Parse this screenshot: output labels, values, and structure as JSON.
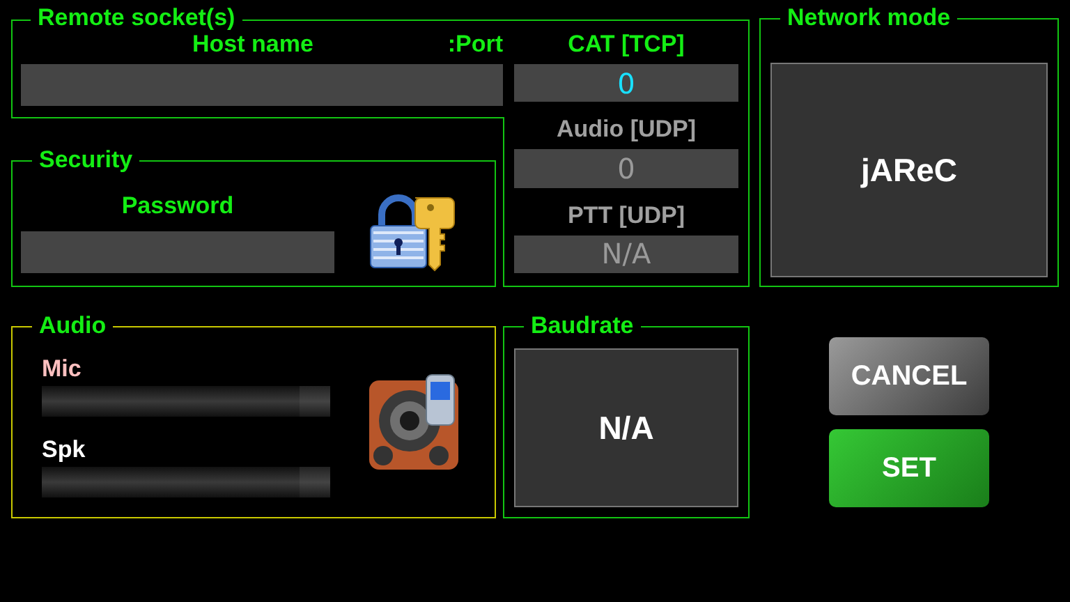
{
  "remote": {
    "legend": "Remote socket(s)",
    "host_label": "Host name",
    "port_label": ":Port"
  },
  "ports": [
    {
      "label": "CAT [TCP]",
      "value": "0",
      "disabled": false
    },
    {
      "label": "Audio [UDP]",
      "value": "0",
      "disabled": true
    },
    {
      "label": "PTT [UDP]",
      "value": "N/A",
      "disabled": true
    }
  ],
  "security": {
    "legend": "Security",
    "password_label": "Password"
  },
  "network": {
    "legend": "Network mode",
    "value": "jAReC"
  },
  "audio": {
    "legend": "Audio",
    "sliders": [
      {
        "label": "Mic",
        "color": "#ffc0c0",
        "level": 1
      },
      {
        "label": "Spk",
        "color": "#ffffff",
        "level": 1
      }
    ]
  },
  "baudrate": {
    "legend": "Baudrate",
    "value": "N/A"
  },
  "buttons": [
    {
      "label": "CANCEL",
      "kind": "cancel"
    },
    {
      "label": "SET",
      "kind": "confirm"
    }
  ]
}
